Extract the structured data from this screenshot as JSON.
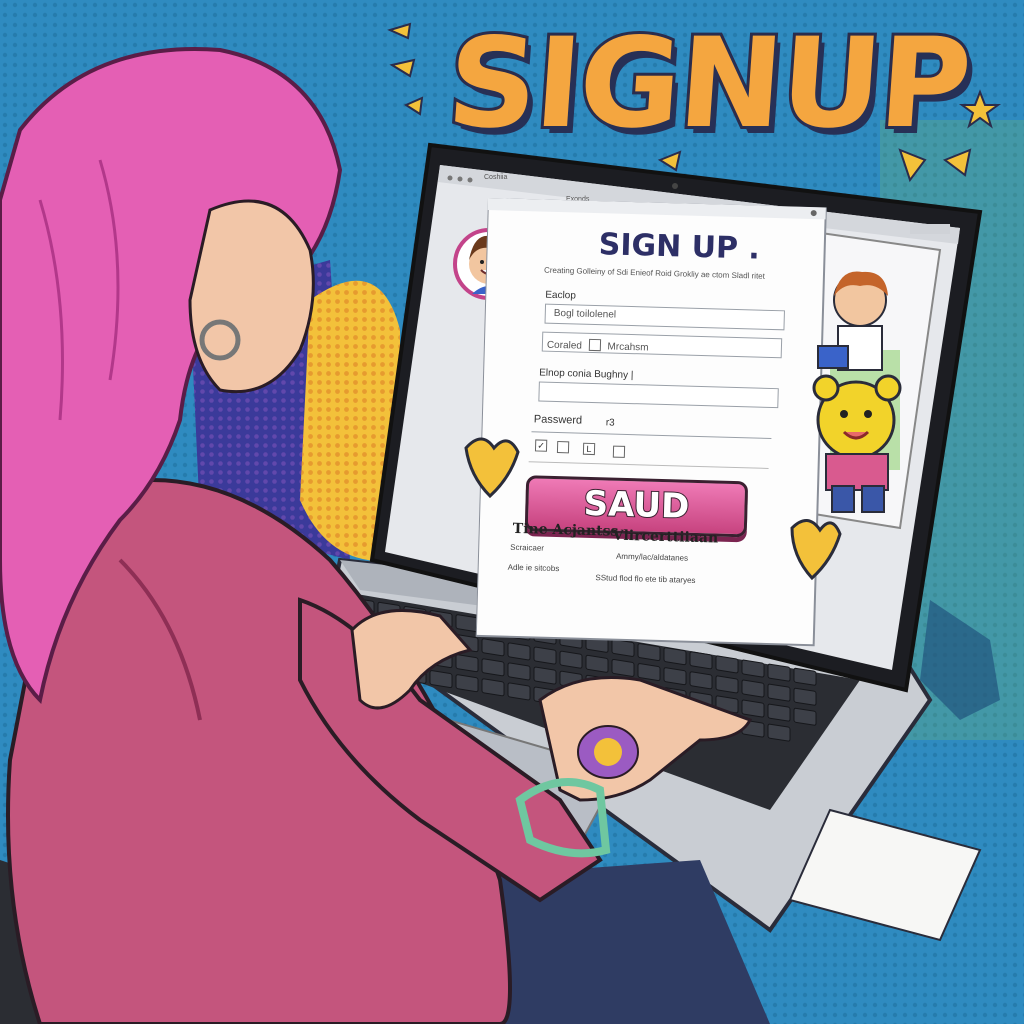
{
  "headline": "SIGNUP",
  "browser": {
    "back_tab": "Coshiia",
    "front_tab": "Exonds"
  },
  "form": {
    "title": "SIGN UP .",
    "intro": "Creating Golleiny of Sdi Enieof Roid Grokliy ae ctom Sladl ritet",
    "username_label": "Eaclop",
    "username_value": "Bogl toilolenel",
    "email_label": "Coraled",
    "email_inline": "Mrcahsm",
    "name_label": "Elnop conia Bughny |",
    "password_label": "Passwerd",
    "password_suffix": "r3",
    "checkbox_2": "L",
    "submit_label": "SAUD",
    "footer": {
      "heading_left": "Tine Acjantss",
      "heading_right": "Vlircerttiiaan",
      "sub_left": "Scraicaer",
      "sub_right": "Ammy/lac/aldatanes",
      "link_left": "Adle ie sitcobs",
      "link_right": "SStud flod  flo  ete tib ataryes"
    }
  },
  "colors": {
    "background": "#2f8bc0",
    "hair": "#e45fb4",
    "jacket": "#c4557d",
    "button": "#dd5f9e",
    "headline": "#f4a640",
    "form_title": "#2d2f66"
  }
}
